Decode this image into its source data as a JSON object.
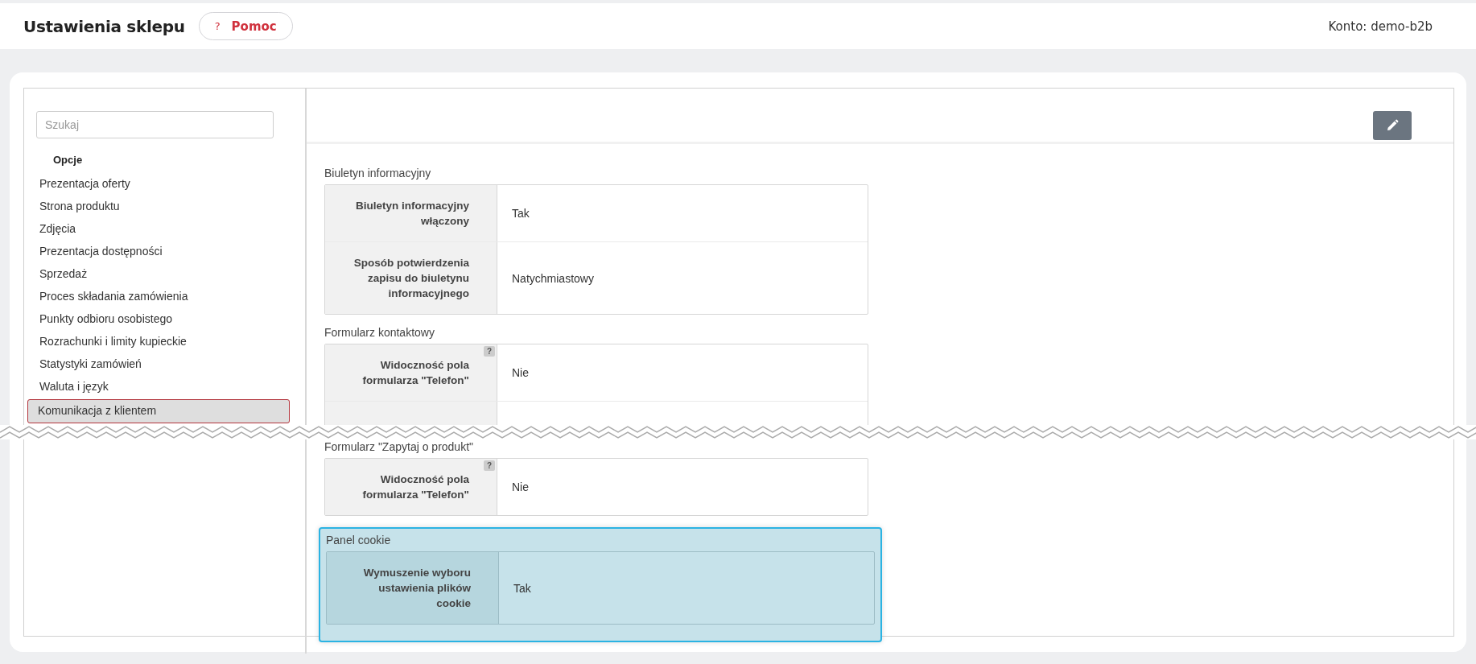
{
  "header": {
    "title": "Ustawienia sklepu",
    "help_button": {
      "icon": "?",
      "label": "Pomoc"
    },
    "account": "Konto: demo-b2b"
  },
  "sidebar": {
    "search": {
      "placeholder": "Szukaj"
    },
    "heading": "Opcje",
    "items": [
      {
        "label": "Prezentacja oferty",
        "selected": false
      },
      {
        "label": "Strona produktu",
        "selected": false
      },
      {
        "label": "Zdjęcia",
        "selected": false
      },
      {
        "label": "Prezentacja dostępności",
        "selected": false
      },
      {
        "label": "Sprzedaż",
        "selected": false
      },
      {
        "label": "Proces składania zamówienia",
        "selected": false
      },
      {
        "label": "Punkty odbioru osobistego",
        "selected": false
      },
      {
        "label": "Rozrachunki i limity kupieckie",
        "selected": false
      },
      {
        "label": "Statystyki zamówień",
        "selected": false
      },
      {
        "label": "Waluta i język",
        "selected": false
      },
      {
        "label": "Komunikacja z klientem",
        "selected": true
      }
    ]
  },
  "main": {
    "sections_above_tear": [
      {
        "title": "Biuletyn informacyjny",
        "highlighted": false,
        "continues": false,
        "rows": [
          {
            "label": "Biuletyn informacyjny włączony",
            "value": "Tak"
          },
          {
            "label": "Sposób potwierdzenia zapisu do biuletynu informacyjnego",
            "value": "Natychmiastowy"
          }
        ]
      },
      {
        "title": "Formularz kontaktowy",
        "highlighted": false,
        "continues": true,
        "rows": [
          {
            "label": "Widoczność pola formularza \"Telefon\"",
            "value": "Nie",
            "help": "?"
          }
        ]
      }
    ],
    "sections_below_tear": [
      {
        "title": "Formularz \"Zapytaj o produkt\"",
        "highlighted": false,
        "continues": false,
        "rows": [
          {
            "label": "Widoczność pola formularza \"Telefon\"",
            "value": "Nie",
            "help": "?"
          }
        ]
      },
      {
        "title": "Panel cookie",
        "highlighted": true,
        "continues": false,
        "rows": [
          {
            "label": "Wymuszenie wyboru ustawienia plików cookie",
            "value": "Tak"
          }
        ]
      }
    ]
  }
}
